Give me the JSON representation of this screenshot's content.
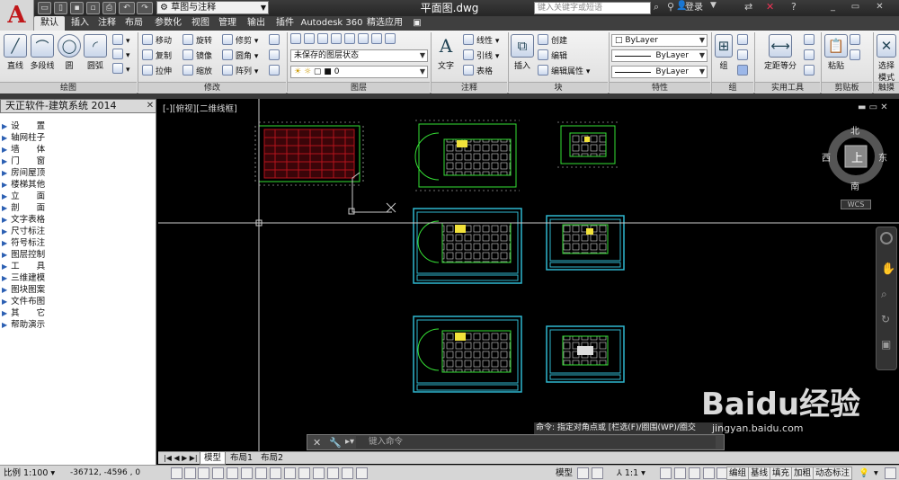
{
  "titlebar": {
    "workspace": "草图与注释",
    "doc_title": "平面图.dwg",
    "search_placeholder": "键入关键字或短语",
    "login": "登录"
  },
  "tabs": [
    {
      "label": "默认",
      "active": true
    },
    {
      "label": "插入"
    },
    {
      "label": "注释"
    },
    {
      "label": "布局"
    },
    {
      "label": "参数化"
    },
    {
      "label": "视图"
    },
    {
      "label": "管理"
    },
    {
      "label": "输出"
    },
    {
      "label": "插件"
    },
    {
      "label": "Autodesk 360"
    },
    {
      "label": "精选应用"
    }
  ],
  "ribbon": {
    "draw": {
      "title": "绘图",
      "line": "直线",
      "polyline": "多段线",
      "circle": "圆",
      "arc": "圆弧"
    },
    "modify": {
      "title": "修改",
      "move": "移动",
      "rotate": "旋转",
      "trim": "修剪",
      "copy": "复制",
      "mirror": "镜像",
      "fillet": "圆角",
      "stretch": "拉伸",
      "scale": "缩放",
      "array": "阵列"
    },
    "layers": {
      "title": "图层",
      "state": "未保存的图层状态",
      "current": "0"
    },
    "annotation": {
      "title": "注释",
      "text": "文字",
      "linear": "线性",
      "leader": "引线",
      "table": "表格"
    },
    "block": {
      "title": "块",
      "insert": "插入",
      "create": "创建",
      "edit": "编辑",
      "edit_attr": "编辑属性"
    },
    "properties": {
      "title": "特性",
      "color": "ByLayer",
      "linetype": "ByLayer",
      "lineweight": "ByLayer"
    },
    "groups": {
      "title": "组",
      "group": "组"
    },
    "utilities": {
      "title": "实用工具",
      "measure": "定距等分"
    },
    "clipboard": {
      "title": "剪贴板",
      "paste": "粘贴"
    },
    "touch": {
      "title": "触摸",
      "select_mode": "选择",
      "select_mode2": "模式"
    }
  },
  "left_panel": {
    "title": "天正软件-建筑系统 2014",
    "items": [
      "设　　置",
      "轴网柱子",
      "墙　　体",
      "门　　窗",
      "房间屋顶",
      "楼梯其他",
      "立　　面",
      "剖　　面",
      "文字表格",
      "尺寸标注",
      "符号标注",
      "图层控制",
      "工　　具",
      "三维建模",
      "图块图案",
      "文件布图",
      "其　　它",
      "帮助演示"
    ]
  },
  "viewport": {
    "label": "[-][俯视][二维线框]"
  },
  "viewcube": {
    "north": "北",
    "south": "南",
    "east": "东",
    "west": "西",
    "top": "上",
    "wcs": "WCS"
  },
  "command": {
    "history": "命令: 指定对角点或 [栏选(F)/圈围(WP)/圈交",
    "placeholder": "键入命令"
  },
  "layout_tabs": [
    {
      "label": "模型",
      "active": true
    },
    {
      "label": "布局1"
    },
    {
      "label": "布局2"
    }
  ],
  "status": {
    "scale": "比例 1:100",
    "coords": "-36712, -4596 , 0",
    "model": "模型",
    "anno_scale": "1:1",
    "btn_edit": "编组",
    "btn_baseline": "基线",
    "btn_fill": "填充",
    "btn_bold": "加粗",
    "btn_dyn": "动态标注"
  },
  "watermark": {
    "brand": "Baidu经验",
    "url": "jingyan.baidu.com"
  },
  "colors": {
    "ribbon_bg": "#e6e6e6",
    "canvas": "#000000",
    "green_lines": "#35e035",
    "cyan_frame": "#2fb7d0",
    "red_grid": "#b3121c",
    "yellow_fill": "#f2e23a"
  }
}
